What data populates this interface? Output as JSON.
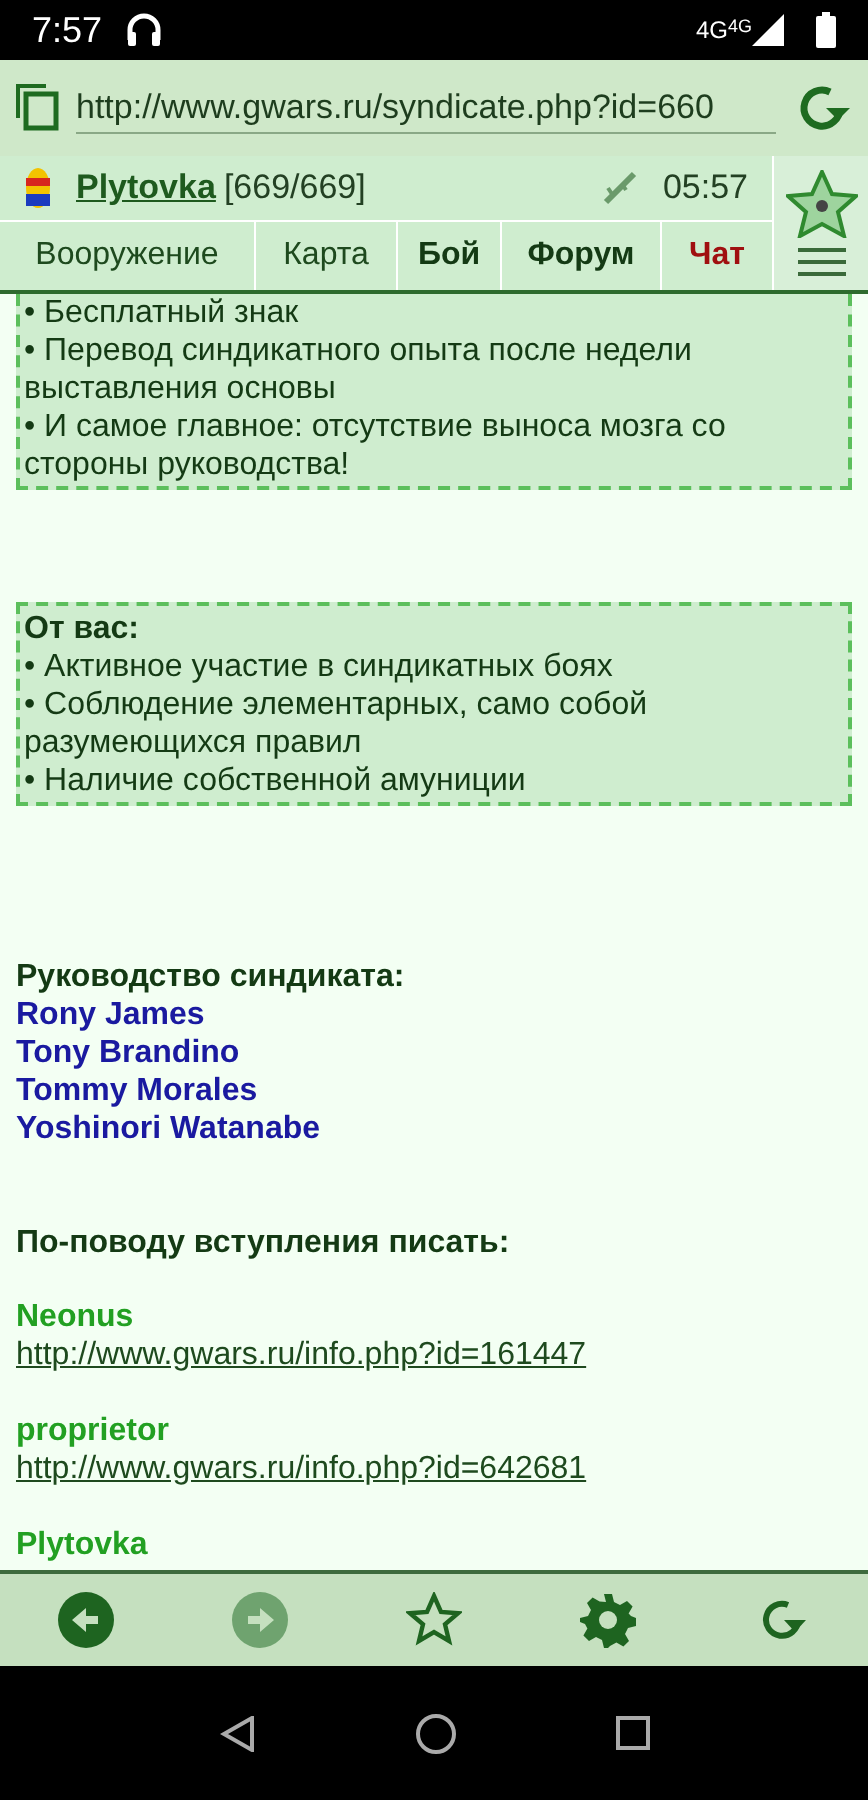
{
  "status_bar": {
    "time": "7:57",
    "network": "4G",
    "network_2": "4G"
  },
  "address_bar": {
    "url": "http://www.gwars.ru/syndicate.php?id=660"
  },
  "game_header": {
    "player": "Plytovka",
    "hp": "[669/669]",
    "time": "05:57",
    "tabs": [
      {
        "label": "Вооружение",
        "kind": "plain"
      },
      {
        "label": "Карта",
        "kind": "plain"
      },
      {
        "label": "Бой",
        "kind": "bold"
      },
      {
        "label": "Форум",
        "kind": "bold"
      },
      {
        "label": "Чат",
        "kind": "alert"
      }
    ]
  },
  "offer_box": {
    "items": [
      "• Бесплатный знак",
      "• Перевод синдикатного опыта после недели выставления основы",
      "• И самое главное: отсутствие выноса мозга со стороны руководства!"
    ]
  },
  "requirements_box": {
    "title": "От вас:",
    "items": [
      "• Активное участие в синдикатных боях",
      "• Соблюдение элементарных, само собой разумеющихся правил",
      "• Наличие собственной амуниции"
    ]
  },
  "leadership": {
    "title": "Руководство синдиката:",
    "members": [
      "Rony James",
      "Tony Brandino",
      "Tommy Morales",
      "Yoshinori Watanabe"
    ]
  },
  "contacts": {
    "title": "По-поводу вступления писать:",
    "entries": [
      {
        "name": "Neonus",
        "url": "http://www.gwars.ru/info.php?id=161447"
      },
      {
        "name": "proprietor",
        "url": "http://www.gwars.ru/info.php?id=642681"
      },
      {
        "name": "Plytovka"
      }
    ]
  },
  "toolbar": [
    {
      "kind": "back",
      "disabled": false
    },
    {
      "kind": "forward",
      "disabled": true
    },
    {
      "kind": "bookmark",
      "disabled": false
    },
    {
      "kind": "settings",
      "disabled": false
    },
    {
      "kind": "reload",
      "disabled": false
    }
  ]
}
